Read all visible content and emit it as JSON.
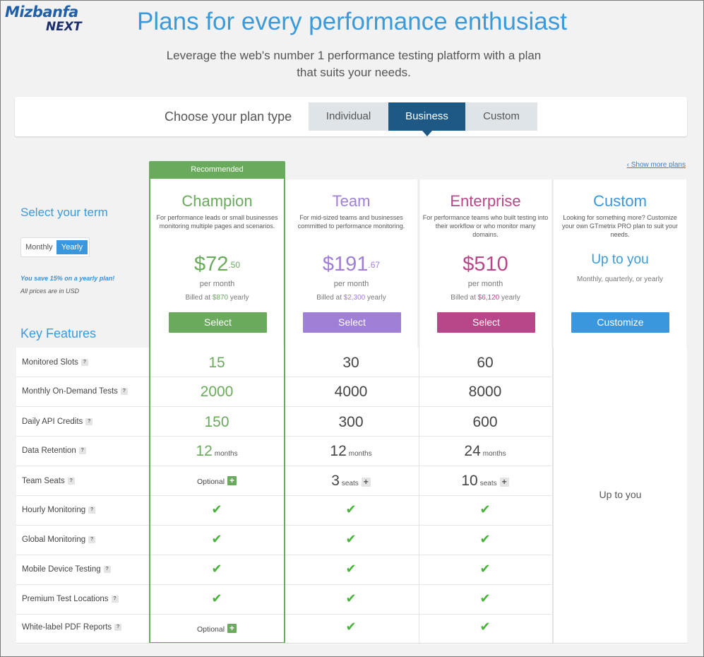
{
  "logo": {
    "line1": "Mizbanfa",
    "line2": "NEXT"
  },
  "header": {
    "title": "Plans for every performance enthusiast",
    "subtitle": "Leverage the web's number 1 performance testing platform with a plan that suits your needs."
  },
  "plan_type": {
    "label": "Choose your plan type",
    "options": [
      "Individual",
      "Business",
      "Custom"
    ],
    "selected": "Business"
  },
  "show_more": "‹ Show more plans",
  "term": {
    "title": "Select your term",
    "monthly": "Monthly",
    "yearly": "Yearly",
    "selected": "Yearly",
    "savings": "You save 15% on a yearly plan!",
    "currency_note": "All prices are in USD"
  },
  "key_features_title": "Key Features",
  "recommended_label": "Recommended",
  "plans": [
    {
      "name": "Champion",
      "color": "#6aaa5c",
      "description": "For performance leads or small businesses monitoring multiple pages and scenarios.",
      "price_main": "$72",
      "price_cents": ".50",
      "per": "per month",
      "billed_prefix": "Billed at ",
      "billed_amount": "$870",
      "billed_suffix": " yearly",
      "button": "Select"
    },
    {
      "name": "Team",
      "color": "#a07fd6",
      "description": "For mid-sized teams and businesses committed to performance monitoring.",
      "price_main": "$191",
      "price_cents": ".67",
      "per": "per month",
      "billed_prefix": "Billed at ",
      "billed_amount": "$2,300",
      "billed_suffix": " yearly",
      "button": "Select"
    },
    {
      "name": "Enterprise",
      "color": "#b8478a",
      "description": "For performance teams who built testing into their workflow or who monitor many domains.",
      "price_main": "$510",
      "price_cents": "",
      "per": "per month",
      "billed_prefix": "Billed at ",
      "billed_amount": "$6,120",
      "billed_suffix": " yearly",
      "button": "Select"
    }
  ],
  "custom_plan": {
    "name": "Custom",
    "color": "#3a97dd",
    "description": "Looking for something more? Customize your own GTmetrix PRO plan to suit your needs.",
    "price_text": "Up to you",
    "frequency": "Monthly, quarterly, or yearly",
    "button": "Customize",
    "table_value": "Up to you"
  },
  "question_mark": "?",
  "features": [
    {
      "name": "Monitored Slots",
      "values": [
        "15",
        "30",
        "60"
      ]
    },
    {
      "name": "Monthly On-Demand Tests",
      "values": [
        "2000",
        "4000",
        "8000"
      ]
    },
    {
      "name": "Daily API Credits",
      "values": [
        "150",
        "300",
        "600"
      ]
    },
    {
      "name": "Data Retention",
      "values": [
        "12",
        "12",
        "24"
      ],
      "unit": "months"
    },
    {
      "name": "Team Seats",
      "values": [
        "Optional",
        "3",
        "10"
      ],
      "unit": "seats"
    },
    {
      "name": "Hourly Monitoring",
      "check": true
    },
    {
      "name": "Global Monitoring",
      "check": true
    },
    {
      "name": "Mobile Device Testing",
      "check": true
    },
    {
      "name": "Premium Test Locations",
      "check": true
    },
    {
      "name": "White-label PDF Reports",
      "values": [
        "Optional"
      ],
      "check": true
    }
  ]
}
